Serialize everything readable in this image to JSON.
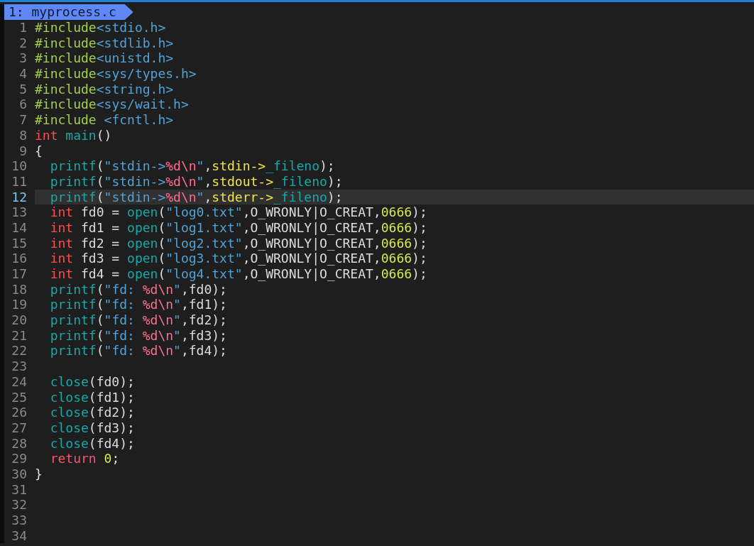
{
  "tab": {
    "label": "1: myprocess.c",
    "selected": true
  },
  "lines": [
    {
      "number": "1",
      "current": false,
      "tokens": [
        {
          "kind": "pre",
          "text": "#include"
        },
        {
          "kind": "hdr",
          "text": "<stdio.h>"
        }
      ]
    },
    {
      "number": "2",
      "current": false,
      "tokens": [
        {
          "kind": "pre",
          "text": "#include"
        },
        {
          "kind": "hdr",
          "text": "<stdlib.h>"
        }
      ]
    },
    {
      "number": "3",
      "current": false,
      "tokens": [
        {
          "kind": "pre",
          "text": "#include"
        },
        {
          "kind": "hdr",
          "text": "<unistd.h>"
        }
      ]
    },
    {
      "number": "4",
      "current": false,
      "tokens": [
        {
          "kind": "pre",
          "text": "#include"
        },
        {
          "kind": "hdr",
          "text": "<sys/types.h>"
        }
      ]
    },
    {
      "number": "5",
      "current": false,
      "tokens": [
        {
          "kind": "pre",
          "text": "#include"
        },
        {
          "kind": "hdr",
          "text": "<string.h>"
        }
      ]
    },
    {
      "number": "6",
      "current": false,
      "tokens": [
        {
          "kind": "pre",
          "text": "#include"
        },
        {
          "kind": "hdr",
          "text": "<sys/wait.h>"
        }
      ]
    },
    {
      "number": "7",
      "current": false,
      "tokens": [
        {
          "kind": "pre",
          "text": "#include"
        },
        {
          "kind": "hdr",
          "text": " <fcntl.h>"
        }
      ]
    },
    {
      "number": "8",
      "current": false,
      "tokens": [
        {
          "kind": "type",
          "text": "int"
        },
        {
          "kind": "fn",
          "text": " main"
        },
        {
          "kind": "p",
          "text": "()"
        }
      ]
    },
    {
      "number": "9",
      "current": false,
      "tokens": [
        {
          "kind": "p",
          "text": "{"
        }
      ]
    },
    {
      "number": "10",
      "current": false,
      "tokens": [
        {
          "kind": "fn",
          "text": "  printf"
        },
        {
          "kind": "p",
          "text": "("
        },
        {
          "kind": "str",
          "text": "\"stdin->"
        },
        {
          "kind": "fmt",
          "text": "%d\\n"
        },
        {
          "kind": "str",
          "text": "\""
        },
        {
          "kind": "p",
          "text": ","
        },
        {
          "kind": "std",
          "text": "stdin->"
        },
        {
          "kind": "mem",
          "text": "_fileno"
        },
        {
          "kind": "p",
          "text": ");"
        }
      ]
    },
    {
      "number": "11",
      "current": false,
      "tokens": [
        {
          "kind": "fn",
          "text": "  printf"
        },
        {
          "kind": "p",
          "text": "("
        },
        {
          "kind": "str",
          "text": "\"stdin->"
        },
        {
          "kind": "fmt",
          "text": "%d\\n"
        },
        {
          "kind": "str",
          "text": "\""
        },
        {
          "kind": "p",
          "text": ","
        },
        {
          "kind": "std",
          "text": "stdout->"
        },
        {
          "kind": "mem",
          "text": "_fileno"
        },
        {
          "kind": "p",
          "text": ");"
        }
      ]
    },
    {
      "number": "12",
      "current": true,
      "tokens": [
        {
          "kind": "fn",
          "text": "  printf"
        },
        {
          "kind": "p",
          "text": "("
        },
        {
          "kind": "str",
          "text": "\"stdin->"
        },
        {
          "kind": "fmt",
          "text": "%d\\n"
        },
        {
          "kind": "str",
          "text": "\""
        },
        {
          "kind": "p",
          "text": ","
        },
        {
          "kind": "std",
          "text": "stderr->"
        },
        {
          "kind": "mem",
          "text": "_fileno"
        },
        {
          "kind": "p",
          "text": ");"
        }
      ]
    },
    {
      "number": "13",
      "current": false,
      "tokens": [
        {
          "kind": "type",
          "text": "  int"
        },
        {
          "kind": "p",
          "text": " fd0 = "
        },
        {
          "kind": "fn",
          "text": "open"
        },
        {
          "kind": "p",
          "text": "("
        },
        {
          "kind": "str",
          "text": "\"log0.txt\""
        },
        {
          "kind": "p",
          "text": ",O_WRONLY|O_CREAT,"
        },
        {
          "kind": "num",
          "text": "0666"
        },
        {
          "kind": "p",
          "text": ");"
        }
      ]
    },
    {
      "number": "14",
      "current": false,
      "tokens": [
        {
          "kind": "type",
          "text": "  int"
        },
        {
          "kind": "p",
          "text": " fd1 = "
        },
        {
          "kind": "fn",
          "text": "open"
        },
        {
          "kind": "p",
          "text": "("
        },
        {
          "kind": "str",
          "text": "\"log1.txt\""
        },
        {
          "kind": "p",
          "text": ",O_WRONLY|O_CREAT,"
        },
        {
          "kind": "num",
          "text": "0666"
        },
        {
          "kind": "p",
          "text": ");"
        }
      ]
    },
    {
      "number": "15",
      "current": false,
      "tokens": [
        {
          "kind": "type",
          "text": "  int"
        },
        {
          "kind": "p",
          "text": " fd2 = "
        },
        {
          "kind": "fn",
          "text": "open"
        },
        {
          "kind": "p",
          "text": "("
        },
        {
          "kind": "str",
          "text": "\"log2.txt\""
        },
        {
          "kind": "p",
          "text": ",O_WRONLY|O_CREAT,"
        },
        {
          "kind": "num",
          "text": "0666"
        },
        {
          "kind": "p",
          "text": ");"
        }
      ]
    },
    {
      "number": "16",
      "current": false,
      "tokens": [
        {
          "kind": "type",
          "text": "  int"
        },
        {
          "kind": "p",
          "text": " fd3 = "
        },
        {
          "kind": "fn",
          "text": "open"
        },
        {
          "kind": "p",
          "text": "("
        },
        {
          "kind": "str",
          "text": "\"log3.txt\""
        },
        {
          "kind": "p",
          "text": ",O_WRONLY|O_CREAT,"
        },
        {
          "kind": "num",
          "text": "0666"
        },
        {
          "kind": "p",
          "text": ");"
        }
      ]
    },
    {
      "number": "17",
      "current": false,
      "tokens": [
        {
          "kind": "type",
          "text": "  int"
        },
        {
          "kind": "p",
          "text": " fd4 = "
        },
        {
          "kind": "fn",
          "text": "open"
        },
        {
          "kind": "p",
          "text": "("
        },
        {
          "kind": "str",
          "text": "\"log4.txt\""
        },
        {
          "kind": "p",
          "text": ",O_WRONLY|O_CREAT,"
        },
        {
          "kind": "num",
          "text": "0666"
        },
        {
          "kind": "p",
          "text": ");"
        }
      ]
    },
    {
      "number": "18",
      "current": false,
      "tokens": [
        {
          "kind": "fn",
          "text": "  printf"
        },
        {
          "kind": "p",
          "text": "("
        },
        {
          "kind": "str",
          "text": "\"fd: "
        },
        {
          "kind": "fmt",
          "text": "%d\\n"
        },
        {
          "kind": "str",
          "text": "\""
        },
        {
          "kind": "p",
          "text": ",fd0);"
        }
      ]
    },
    {
      "number": "19",
      "current": false,
      "tokens": [
        {
          "kind": "fn",
          "text": "  printf"
        },
        {
          "kind": "p",
          "text": "("
        },
        {
          "kind": "str",
          "text": "\"fd: "
        },
        {
          "kind": "fmt",
          "text": "%d\\n"
        },
        {
          "kind": "str",
          "text": "\""
        },
        {
          "kind": "p",
          "text": ",fd1);"
        }
      ]
    },
    {
      "number": "20",
      "current": false,
      "tokens": [
        {
          "kind": "fn",
          "text": "  printf"
        },
        {
          "kind": "p",
          "text": "("
        },
        {
          "kind": "str",
          "text": "\"fd: "
        },
        {
          "kind": "fmt",
          "text": "%d\\n"
        },
        {
          "kind": "str",
          "text": "\""
        },
        {
          "kind": "p",
          "text": ",fd2);"
        }
      ]
    },
    {
      "number": "21",
      "current": false,
      "tokens": [
        {
          "kind": "fn",
          "text": "  printf"
        },
        {
          "kind": "p",
          "text": "("
        },
        {
          "kind": "str",
          "text": "\"fd: "
        },
        {
          "kind": "fmt",
          "text": "%d\\n"
        },
        {
          "kind": "str",
          "text": "\""
        },
        {
          "kind": "p",
          "text": ",fd3);"
        }
      ]
    },
    {
      "number": "22",
      "current": false,
      "tokens": [
        {
          "kind": "fn",
          "text": "  printf"
        },
        {
          "kind": "p",
          "text": "("
        },
        {
          "kind": "str",
          "text": "\"fd: "
        },
        {
          "kind": "fmt",
          "text": "%d\\n"
        },
        {
          "kind": "str",
          "text": "\""
        },
        {
          "kind": "p",
          "text": ",fd4);"
        }
      ]
    },
    {
      "number": "23",
      "current": false
    },
    {
      "number": "24",
      "current": false,
      "tokens": [
        {
          "kind": "fn",
          "text": "  close"
        },
        {
          "kind": "p",
          "text": "(fd0);"
        }
      ]
    },
    {
      "number": "25",
      "current": false,
      "tokens": [
        {
          "kind": "fn",
          "text": "  close"
        },
        {
          "kind": "p",
          "text": "(fd1);"
        }
      ]
    },
    {
      "number": "26",
      "current": false,
      "tokens": [
        {
          "kind": "fn",
          "text": "  close"
        },
        {
          "kind": "p",
          "text": "(fd2);"
        }
      ]
    },
    {
      "number": "27",
      "current": false,
      "tokens": [
        {
          "kind": "fn",
          "text": "  close"
        },
        {
          "kind": "p",
          "text": "(fd3);"
        }
      ]
    },
    {
      "number": "28",
      "current": false,
      "tokens": [
        {
          "kind": "fn",
          "text": "  close"
        },
        {
          "kind": "p",
          "text": "(fd4);"
        }
      ]
    },
    {
      "number": "29",
      "current": false,
      "tokens": [
        {
          "kind": "kw",
          "text": "  return"
        },
        {
          "kind": "num",
          "text": " 0"
        },
        {
          "kind": "p",
          "text": ";"
        }
      ]
    },
    {
      "number": "30",
      "current": false,
      "tokens": [
        {
          "kind": "p",
          "text": "}"
        }
      ]
    },
    {
      "number": "31",
      "current": false
    },
    {
      "number": "32",
      "current": false
    },
    {
      "number": "33",
      "current": false
    },
    {
      "number": "34",
      "current": false
    }
  ]
}
